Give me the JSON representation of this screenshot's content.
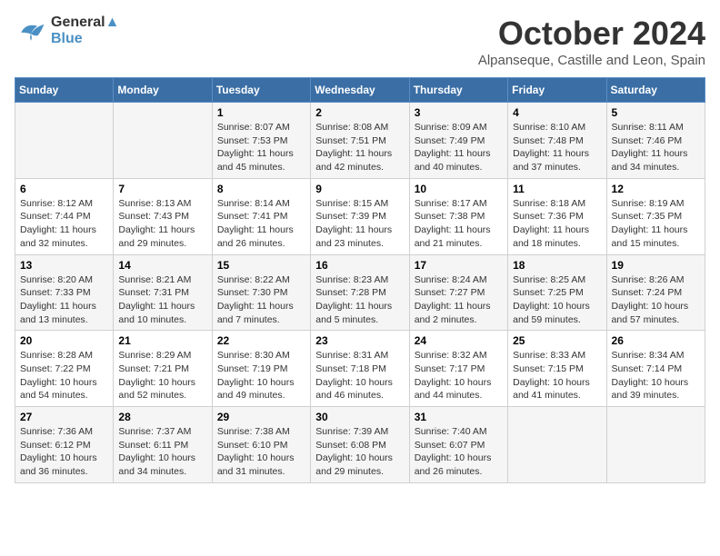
{
  "header": {
    "logo_line1": "General",
    "logo_line2": "Blue",
    "month_title": "October 2024",
    "location": "Alpanseque, Castille and Leon, Spain"
  },
  "days_of_week": [
    "Sunday",
    "Monday",
    "Tuesday",
    "Wednesday",
    "Thursday",
    "Friday",
    "Saturday"
  ],
  "weeks": [
    [
      {
        "day": "",
        "info": ""
      },
      {
        "day": "",
        "info": ""
      },
      {
        "day": "1",
        "sunrise": "8:07 AM",
        "sunset": "7:53 PM",
        "daylight": "11 hours and 45 minutes."
      },
      {
        "day": "2",
        "sunrise": "8:08 AM",
        "sunset": "7:51 PM",
        "daylight": "11 hours and 42 minutes."
      },
      {
        "day": "3",
        "sunrise": "8:09 AM",
        "sunset": "7:49 PM",
        "daylight": "11 hours and 40 minutes."
      },
      {
        "day": "4",
        "sunrise": "8:10 AM",
        "sunset": "7:48 PM",
        "daylight": "11 hours and 37 minutes."
      },
      {
        "day": "5",
        "sunrise": "8:11 AM",
        "sunset": "7:46 PM",
        "daylight": "11 hours and 34 minutes."
      }
    ],
    [
      {
        "day": "6",
        "sunrise": "8:12 AM",
        "sunset": "7:44 PM",
        "daylight": "11 hours and 32 minutes."
      },
      {
        "day": "7",
        "sunrise": "8:13 AM",
        "sunset": "7:43 PM",
        "daylight": "11 hours and 29 minutes."
      },
      {
        "day": "8",
        "sunrise": "8:14 AM",
        "sunset": "7:41 PM",
        "daylight": "11 hours and 26 minutes."
      },
      {
        "day": "9",
        "sunrise": "8:15 AM",
        "sunset": "7:39 PM",
        "daylight": "11 hours and 23 minutes."
      },
      {
        "day": "10",
        "sunrise": "8:17 AM",
        "sunset": "7:38 PM",
        "daylight": "11 hours and 21 minutes."
      },
      {
        "day": "11",
        "sunrise": "8:18 AM",
        "sunset": "7:36 PM",
        "daylight": "11 hours and 18 minutes."
      },
      {
        "day": "12",
        "sunrise": "8:19 AM",
        "sunset": "7:35 PM",
        "daylight": "11 hours and 15 minutes."
      }
    ],
    [
      {
        "day": "13",
        "sunrise": "8:20 AM",
        "sunset": "7:33 PM",
        "daylight": "11 hours and 13 minutes."
      },
      {
        "day": "14",
        "sunrise": "8:21 AM",
        "sunset": "7:31 PM",
        "daylight": "11 hours and 10 minutes."
      },
      {
        "day": "15",
        "sunrise": "8:22 AM",
        "sunset": "7:30 PM",
        "daylight": "11 hours and 7 minutes."
      },
      {
        "day": "16",
        "sunrise": "8:23 AM",
        "sunset": "7:28 PM",
        "daylight": "11 hours and 5 minutes."
      },
      {
        "day": "17",
        "sunrise": "8:24 AM",
        "sunset": "7:27 PM",
        "daylight": "11 hours and 2 minutes."
      },
      {
        "day": "18",
        "sunrise": "8:25 AM",
        "sunset": "7:25 PM",
        "daylight": "10 hours and 59 minutes."
      },
      {
        "day": "19",
        "sunrise": "8:26 AM",
        "sunset": "7:24 PM",
        "daylight": "10 hours and 57 minutes."
      }
    ],
    [
      {
        "day": "20",
        "sunrise": "8:28 AM",
        "sunset": "7:22 PM",
        "daylight": "10 hours and 54 minutes."
      },
      {
        "day": "21",
        "sunrise": "8:29 AM",
        "sunset": "7:21 PM",
        "daylight": "10 hours and 52 minutes."
      },
      {
        "day": "22",
        "sunrise": "8:30 AM",
        "sunset": "7:19 PM",
        "daylight": "10 hours and 49 minutes."
      },
      {
        "day": "23",
        "sunrise": "8:31 AM",
        "sunset": "7:18 PM",
        "daylight": "10 hours and 46 minutes."
      },
      {
        "day": "24",
        "sunrise": "8:32 AM",
        "sunset": "7:17 PM",
        "daylight": "10 hours and 44 minutes."
      },
      {
        "day": "25",
        "sunrise": "8:33 AM",
        "sunset": "7:15 PM",
        "daylight": "10 hours and 41 minutes."
      },
      {
        "day": "26",
        "sunrise": "8:34 AM",
        "sunset": "7:14 PM",
        "daylight": "10 hours and 39 minutes."
      }
    ],
    [
      {
        "day": "27",
        "sunrise": "7:36 AM",
        "sunset": "6:12 PM",
        "daylight": "10 hours and 36 minutes."
      },
      {
        "day": "28",
        "sunrise": "7:37 AM",
        "sunset": "6:11 PM",
        "daylight": "10 hours and 34 minutes."
      },
      {
        "day": "29",
        "sunrise": "7:38 AM",
        "sunset": "6:10 PM",
        "daylight": "10 hours and 31 minutes."
      },
      {
        "day": "30",
        "sunrise": "7:39 AM",
        "sunset": "6:08 PM",
        "daylight": "10 hours and 29 minutes."
      },
      {
        "day": "31",
        "sunrise": "7:40 AM",
        "sunset": "6:07 PM",
        "daylight": "10 hours and 26 minutes."
      },
      {
        "day": "",
        "info": ""
      },
      {
        "day": "",
        "info": ""
      }
    ]
  ],
  "labels": {
    "sunrise": "Sunrise:",
    "sunset": "Sunset:",
    "daylight": "Daylight:"
  }
}
